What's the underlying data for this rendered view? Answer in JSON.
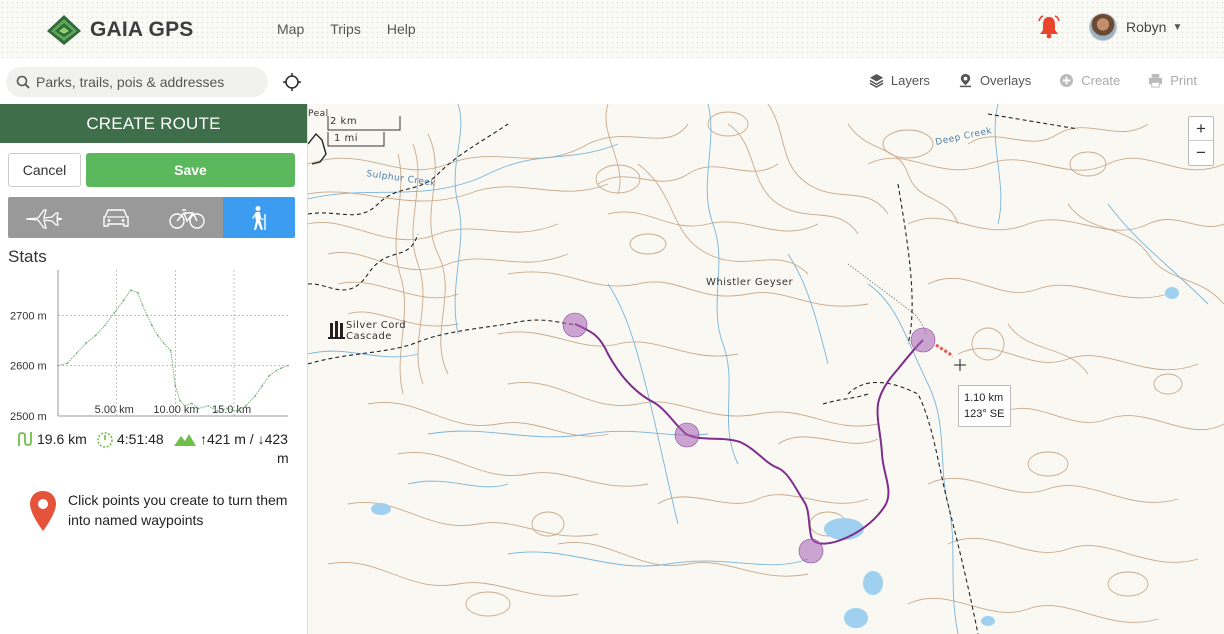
{
  "brand": {
    "name": "GAIA GPS"
  },
  "nav": {
    "items": [
      "Map",
      "Trips",
      "Help"
    ]
  },
  "user": {
    "name": "Robyn"
  },
  "search": {
    "placeholder": "Parks, trails, pois & addresses"
  },
  "toolbar": {
    "layers": "Layers",
    "overlays": "Overlays",
    "create": "Create",
    "print": "Print"
  },
  "panel": {
    "title": "CREATE ROUTE",
    "cancel_label": "Cancel",
    "save_label": "Save",
    "modes": [
      "straight-line",
      "car",
      "bike",
      "hiking"
    ],
    "active_mode": "hiking",
    "stats_label": "Stats",
    "distance": "19.6 km",
    "time": "4:51:48",
    "elevation": "↑421 m / ↓423",
    "elevation_unit": "m",
    "hint": "Click points you create to turn them into named waypoints"
  },
  "chart_data": {
    "type": "line",
    "title": "",
    "xlabel": "",
    "ylabel": "",
    "x_ticks": [
      "5.00 km",
      "10.00 km",
      "15.0 km"
    ],
    "y_ticks": [
      "2700 m",
      "2600 m",
      "2500 m"
    ],
    "ylim": [
      2500,
      2790
    ],
    "xlim": [
      0,
      19.6
    ],
    "grid": true,
    "series": [
      {
        "x": [
          0,
          0.8,
          1.6,
          2.4,
          3.2,
          4.0,
          4.8,
          5.6,
          6.2,
          6.8,
          7.2,
          7.6,
          8.0,
          8.5,
          9.0,
          9.6,
          10.0,
          10.4,
          10.8,
          11.4,
          12.0,
          12.8,
          13.6,
          14.4,
          15.2,
          16.0,
          16.8,
          17.4,
          18.0,
          18.6,
          19.0,
          19.6
        ],
        "values": [
          2600,
          2605,
          2625,
          2645,
          2660,
          2680,
          2705,
          2730,
          2750,
          2745,
          2720,
          2700,
          2680,
          2660,
          2645,
          2630,
          2560,
          2530,
          2520,
          2525,
          2515,
          2520,
          2510,
          2515,
          2510,
          2520,
          2540,
          2560,
          2580,
          2590,
          2595,
          2600
        ]
      }
    ]
  },
  "map": {
    "labels": {
      "whistler": "Whistler Geyser",
      "silver_1": "Silver Cord",
      "silver_2": "Cascade",
      "sulphur": "Sulphur Creek",
      "deep": "Deep Creek",
      "peak": "Peal"
    },
    "scale": {
      "km": "2 km",
      "mi": "1 mi"
    },
    "zoom_in": "+",
    "zoom_out": "−",
    "tooltip": {
      "distance": "1.10 km",
      "bearing": "123° SE"
    },
    "route_color": "#7e2d8c",
    "waypoint_color": "#a45fb5"
  }
}
